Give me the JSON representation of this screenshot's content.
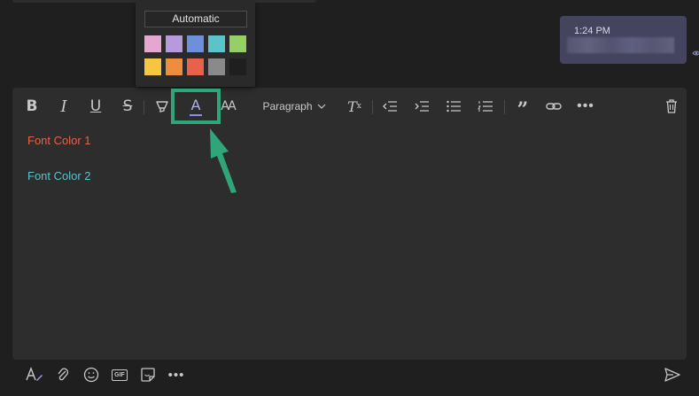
{
  "bubble": {
    "time": "1:24 PM"
  },
  "toolbar": {
    "bold": "B",
    "italic": "I",
    "underline": "U",
    "strikethrough": "S",
    "font_color": "A",
    "font_size": "AA",
    "paragraph": "Paragraph",
    "clear_format": "T",
    "clear_format_sub": "x",
    "quote": "”",
    "more": "•••"
  },
  "color_picker": {
    "automatic_label": "Automatic",
    "swatches": [
      "#e4a7cf",
      "#b69add",
      "#6e8fd9",
      "#5bc4c8",
      "#95cf65",
      "#f6c643",
      "#ee8d3e",
      "#e8614a",
      "#8a8a8a",
      "#1f1f1f"
    ]
  },
  "editor": {
    "line1": "Font Color 1",
    "line1_color": "#e8614a",
    "line2": "Font Color 2",
    "line2_color": "#5bc4c8"
  },
  "bottom_bar": {
    "gif": "GIF",
    "more": "•••"
  },
  "accent_color": "#2fa57a"
}
